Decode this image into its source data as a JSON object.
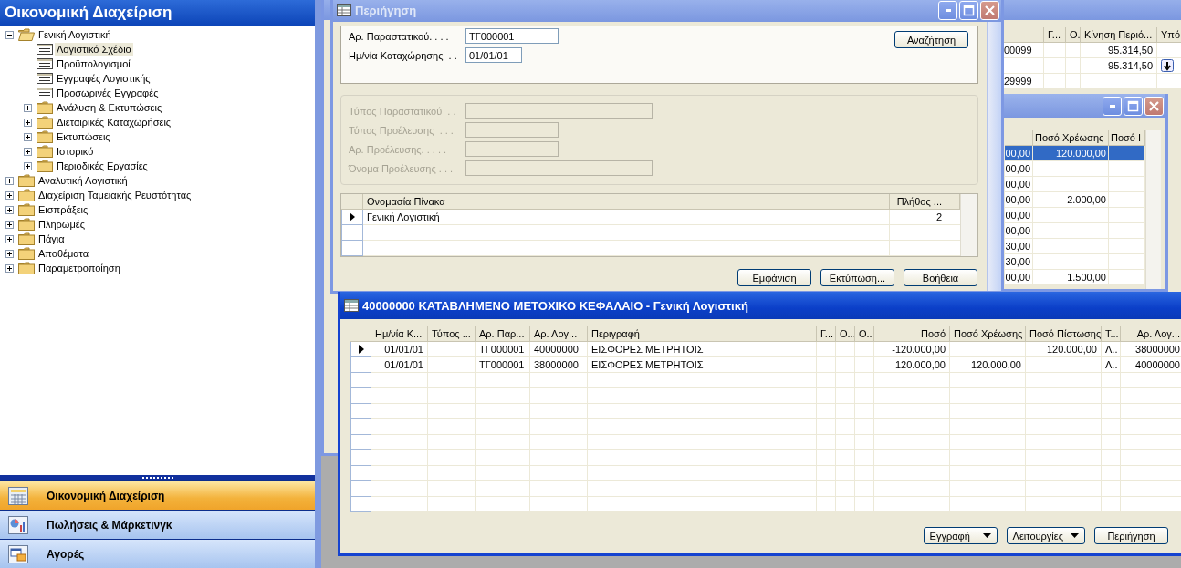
{
  "nav_pane": {
    "title": "Οικονομική Διαχείριση",
    "tree": [
      {
        "label": "Γενική Λογιστική",
        "kind": "folder",
        "expanded": true,
        "selected": false,
        "children": [
          {
            "label": "Λογιστικό Σχέδιο",
            "kind": "page",
            "selected": true
          },
          {
            "label": "Προϋπολογισμοί",
            "kind": "page",
            "selected": false
          },
          {
            "label": "Εγγραφές Λογιστικής",
            "kind": "page",
            "selected": false
          },
          {
            "label": "Προσωρινές Εγγραφές",
            "kind": "page",
            "selected": false
          },
          {
            "label": "Ανάλυση & Εκτυπώσεις",
            "kind": "folder",
            "expanded": false,
            "selected": false
          },
          {
            "label": "Διεταιρικές Καταχωρήσεις",
            "kind": "folder",
            "expanded": false,
            "selected": false
          },
          {
            "label": "Εκτυπώσεις",
            "kind": "folder",
            "expanded": false,
            "selected": false
          },
          {
            "label": "Ιστορικό",
            "kind": "folder",
            "expanded": false,
            "selected": false
          },
          {
            "label": "Περιοδικές Εργασίες",
            "kind": "folder",
            "expanded": false,
            "selected": false
          }
        ]
      },
      {
        "label": "Αναλυτική Λογιστική",
        "kind": "folder",
        "expanded": false,
        "selected": false
      },
      {
        "label": "Διαχείριση Ταμειακής Ρευστότητας",
        "kind": "folder",
        "expanded": false,
        "selected": false
      },
      {
        "label": "Εισπράξεις",
        "kind": "folder",
        "expanded": false,
        "selected": false
      },
      {
        "label": "Πληρωμές",
        "kind": "folder",
        "expanded": false,
        "selected": false
      },
      {
        "label": "Πάγια",
        "kind": "folder",
        "expanded": false,
        "selected": false
      },
      {
        "label": "Αποθέματα",
        "kind": "folder",
        "expanded": false,
        "selected": false
      },
      {
        "label": "Παραμετροποίηση",
        "kind": "folder",
        "expanded": false,
        "selected": false
      }
    ],
    "buttons": [
      {
        "label": "Οικονομική Διαχείριση",
        "kind": "finance",
        "selected": true
      },
      {
        "label": "Πωλήσεις & Μάρκετινγκ",
        "kind": "sales",
        "selected": false
      },
      {
        "label": "Αγορές",
        "kind": "purchases",
        "selected": false
      }
    ]
  },
  "accounts_window": {
    "columns": [
      null,
      "Γ...",
      "Ο.",
      "Κίνηση Περιό...",
      "Υπό"
    ],
    "rows": [
      {
        "cells": [
          "00099",
          null,
          null,
          "95.314,50",
          null
        ],
        "drilldown": false
      },
      {
        "cells": [
          null,
          null,
          null,
          "95.314,50",
          null
        ],
        "drilldown": true
      },
      {
        "cells": [
          "29999",
          null,
          null,
          null,
          null
        ],
        "drilldown": false
      }
    ]
  },
  "entries_window": {
    "columns": [
      null,
      "Ποσό Χρέωσης",
      "Ποσό Ι"
    ],
    "rows": [
      {
        "cells": [
          "00,00",
          "120.000,00",
          null
        ],
        "selected": true
      },
      {
        "cells": [
          "00,00",
          null,
          null
        ],
        "selected": false
      },
      {
        "cells": [
          "00,00",
          null,
          null
        ],
        "selected": false
      },
      {
        "cells": [
          "00,00",
          "2.000,00",
          null
        ],
        "selected": false
      },
      {
        "cells": [
          "00,00",
          null,
          null
        ],
        "selected": false
      },
      {
        "cells": [
          "00,00",
          null,
          null
        ],
        "selected": false
      },
      {
        "cells": [
          "30,00",
          null,
          null
        ],
        "selected": false
      },
      {
        "cells": [
          "30,00",
          null,
          null
        ],
        "selected": false
      },
      {
        "cells": [
          "00,00",
          "1.500,00",
          null
        ],
        "selected": false
      }
    ]
  },
  "navigate_window": {
    "title": "Περιήγηση",
    "search_button": "Αναζήτηση",
    "document_fields": [
      {
        "label": "Αρ. Παραστατικού. . . .",
        "value": "ΤΓ000001",
        "disabled": false
      },
      {
        "label": "Ημ/νία Καταχώρησης  . .",
        "value": "01/01/01",
        "disabled": false
      }
    ],
    "source_fields": [
      {
        "label": "Τύπος Παραστατικού  . .",
        "disabled": true
      },
      {
        "label": "Τύπος Προέλευσης  . . .",
        "disabled": true
      },
      {
        "label": "Αρ. Προέλευσης. . . . .",
        "disabled": true
      },
      {
        "label": "Όνομα Προέλευσης . . .",
        "disabled": true
      }
    ],
    "table": {
      "columns": [
        "Ονομασία Πίνακα",
        "Πλήθος ..."
      ],
      "rows": [
        {
          "cells": [
            "Γενική Λογιστική",
            "2"
          ],
          "current": true
        }
      ]
    },
    "buttons": [
      "Εμφάνιση",
      "Εκτύπωση...",
      "Βοήθεια"
    ]
  },
  "ledger_window": {
    "title": "40000000 ΚΑΤΑΒΛΗΜΕΝΟ ΜΕΤΟΧΙΚΟ ΚΕΦΑΛΑΙΟ - Γενική Λογιστική",
    "columns": [
      "Ημ/νία Κ...",
      "Τύπος ...",
      "Αρ. Παρ...",
      "Αρ. Λογ...",
      "Περιγραφή",
      "Γ...",
      "Ο...",
      "Ο...",
      "Ποσό",
      "Ποσό Χρέωσης",
      "Ποσό Πίστωσης",
      "Τ...",
      "Αρ. Λογ..."
    ],
    "rows": [
      {
        "cells": [
          "01/01/01",
          null,
          "ΤΓ000001",
          "40000000",
          "ΕΙΣΦΟΡΕΣ ΜΕΤΡΗΤΟΙΣ",
          null,
          null,
          null,
          "-120.000,00",
          null,
          "120.000,00",
          "Λ..",
          "38000000"
        ],
        "current": true
      },
      {
        "cells": [
          "01/01/01",
          null,
          "ΤΓ000001",
          "38000000",
          "ΕΙΣΦΟΡΕΣ ΜΕΤΡΗΤΟΙΣ",
          null,
          null,
          null,
          "120.000,00",
          "120.000,00",
          null,
          "Λ..",
          "40000000"
        ],
        "current": false
      }
    ],
    "buttons": [
      {
        "label": "Εγγραφή",
        "kind": "dropdown"
      },
      {
        "label": "Λειτουργίες",
        "kind": "dropdown"
      },
      {
        "label": "Περιήγηση",
        "kind": "button"
      }
    ]
  }
}
